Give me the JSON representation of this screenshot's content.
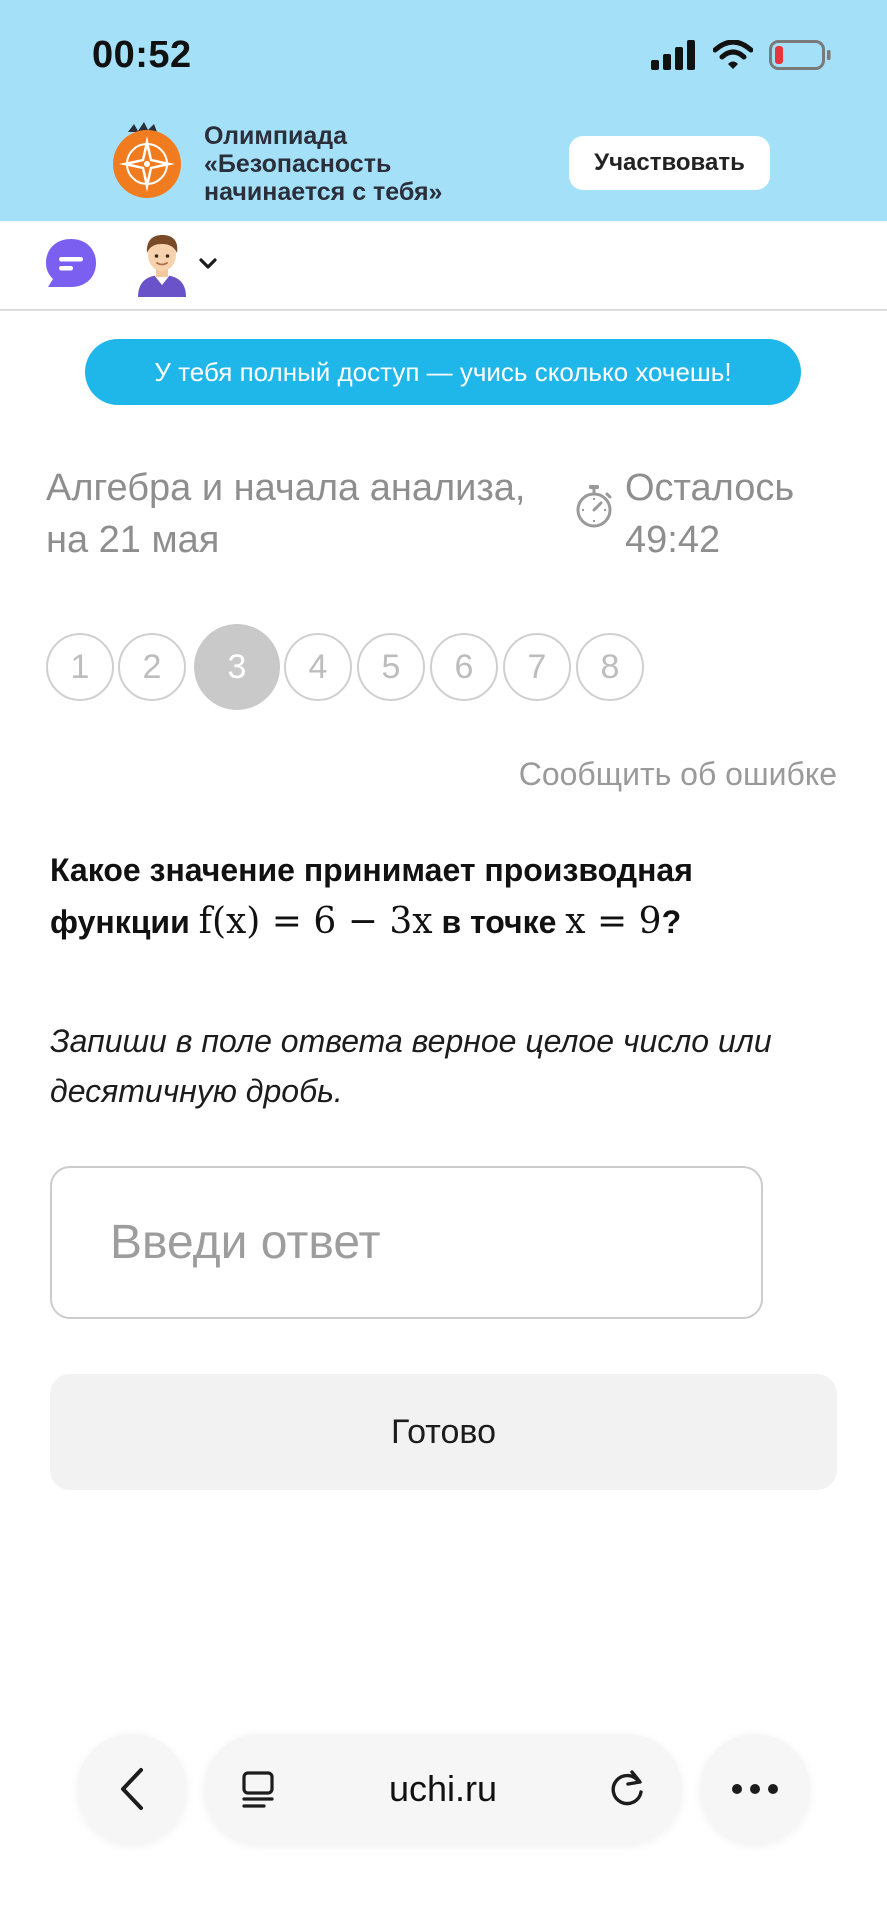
{
  "status_bar": {
    "time": "00:52",
    "icons": [
      "signal-icon",
      "wifi-icon",
      "battery-low-icon"
    ]
  },
  "promo": {
    "line1": "Олимпиада",
    "line2": "«Безопасность",
    "line3": "начинается с тебя»",
    "button_label": "Участвовать",
    "logo_icon": "compass-star-icon",
    "background_color": "#a5e0f9"
  },
  "header": {
    "chat_icon": "chat-bubble-icon",
    "avatar_icon": "user-avatar-icon",
    "menu_icon": "chevron-down-icon"
  },
  "access_banner": {
    "text": "У тебя полный доступ — учись сколько хочешь!",
    "color": "#1fb6ea"
  },
  "task": {
    "subject_line1": "Алгебра и начала анализа,",
    "subject_line2": "на 21 мая",
    "timer_label": "Осталось",
    "timer_value": "49:42",
    "timer_icon": "stopwatch-icon"
  },
  "pagination": {
    "pages": [
      "1",
      "2",
      "3",
      "4",
      "5",
      "6",
      "7",
      "8"
    ],
    "current": "3"
  },
  "report_error": "Сообщить об ошибке",
  "question": {
    "text_part1": "Какое значение принимает производная",
    "text_part2": "функции",
    "formula_function": "f(x) = 6 − 3x",
    "text_part3": "в точке",
    "formula_point": "x = 9",
    "text_part4": "?"
  },
  "instruction": {
    "line1": "Запиши в поле ответа верное целое число или",
    "line2": "десятичную дробь."
  },
  "answer": {
    "placeholder": "Введи ответ",
    "value": ""
  },
  "done_button": "Готово",
  "browser": {
    "back_icon": "chevron-left-icon",
    "tabs_icon": "page-list-icon",
    "url": "uchi.ru",
    "reload_icon": "reload-icon",
    "more_icon": "more-dots-icon"
  }
}
